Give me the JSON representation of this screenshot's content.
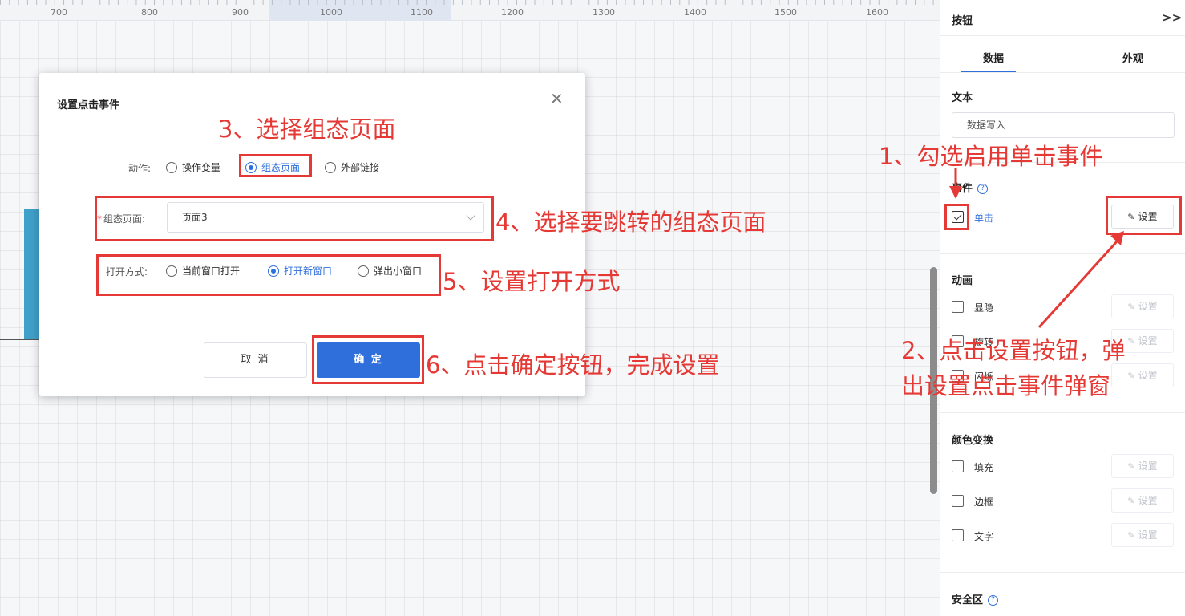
{
  "ruler": {
    "ticks": [
      "700",
      "800",
      "900",
      "1000",
      "1100",
      "1200",
      "1300",
      "1400",
      "1500",
      "1600"
    ]
  },
  "panel": {
    "title": "按钮",
    "collapse_icon": "double-chevron-right-icon",
    "tabs": {
      "data": "数据",
      "appearance": "外观"
    },
    "text_section": {
      "title": "文本",
      "input_value": "数据写入"
    },
    "event_section": {
      "title": "事件",
      "help": "?",
      "click_label": "单击",
      "click_checked": true,
      "set_label": "设置"
    },
    "animation_section": {
      "title": "动画",
      "items": [
        {
          "label": "显隐",
          "set_label": "设置"
        },
        {
          "label": "旋转",
          "set_label": "设置"
        },
        {
          "label": "闪烁",
          "set_label": "设置"
        }
      ]
    },
    "color_section": {
      "title": "颜色变换",
      "items": [
        {
          "label": "填充",
          "set_label": "设置"
        },
        {
          "label": "边框",
          "set_label": "设置"
        },
        {
          "label": "文字",
          "set_label": "设置"
        }
      ]
    },
    "safe_section": {
      "title": "安全区",
      "help": "?"
    }
  },
  "modal": {
    "title": "设置点击事件",
    "action_label": "动作:",
    "actions": [
      "操作变量",
      "组态页面",
      "外部链接"
    ],
    "action_selected": "组态页面",
    "page_label": "组态页面:",
    "page_value": "页面3",
    "open_label": "打开方式:",
    "open_modes": [
      "当前窗口打开",
      "打开新窗口",
      "弹出小窗口"
    ],
    "open_selected": "打开新窗口",
    "cancel_label": "取 消",
    "ok_label": "确 定"
  },
  "annotations": {
    "step1": "1、勾选启用单击事件",
    "step2_line1": "2、点击设置按钮，弹",
    "step2_line2": "出设置点击事件弹窗",
    "step3": "3、选择组态页面",
    "step4": "4、选择要跳转的组态页面",
    "step5": "5、设置打开方式",
    "step6": "6、点击确定按钮，完成设置"
  },
  "colors": {
    "accent": "#2f6fdc",
    "annotation": "#e53935",
    "canvas_bar": "#3fa0c9"
  }
}
